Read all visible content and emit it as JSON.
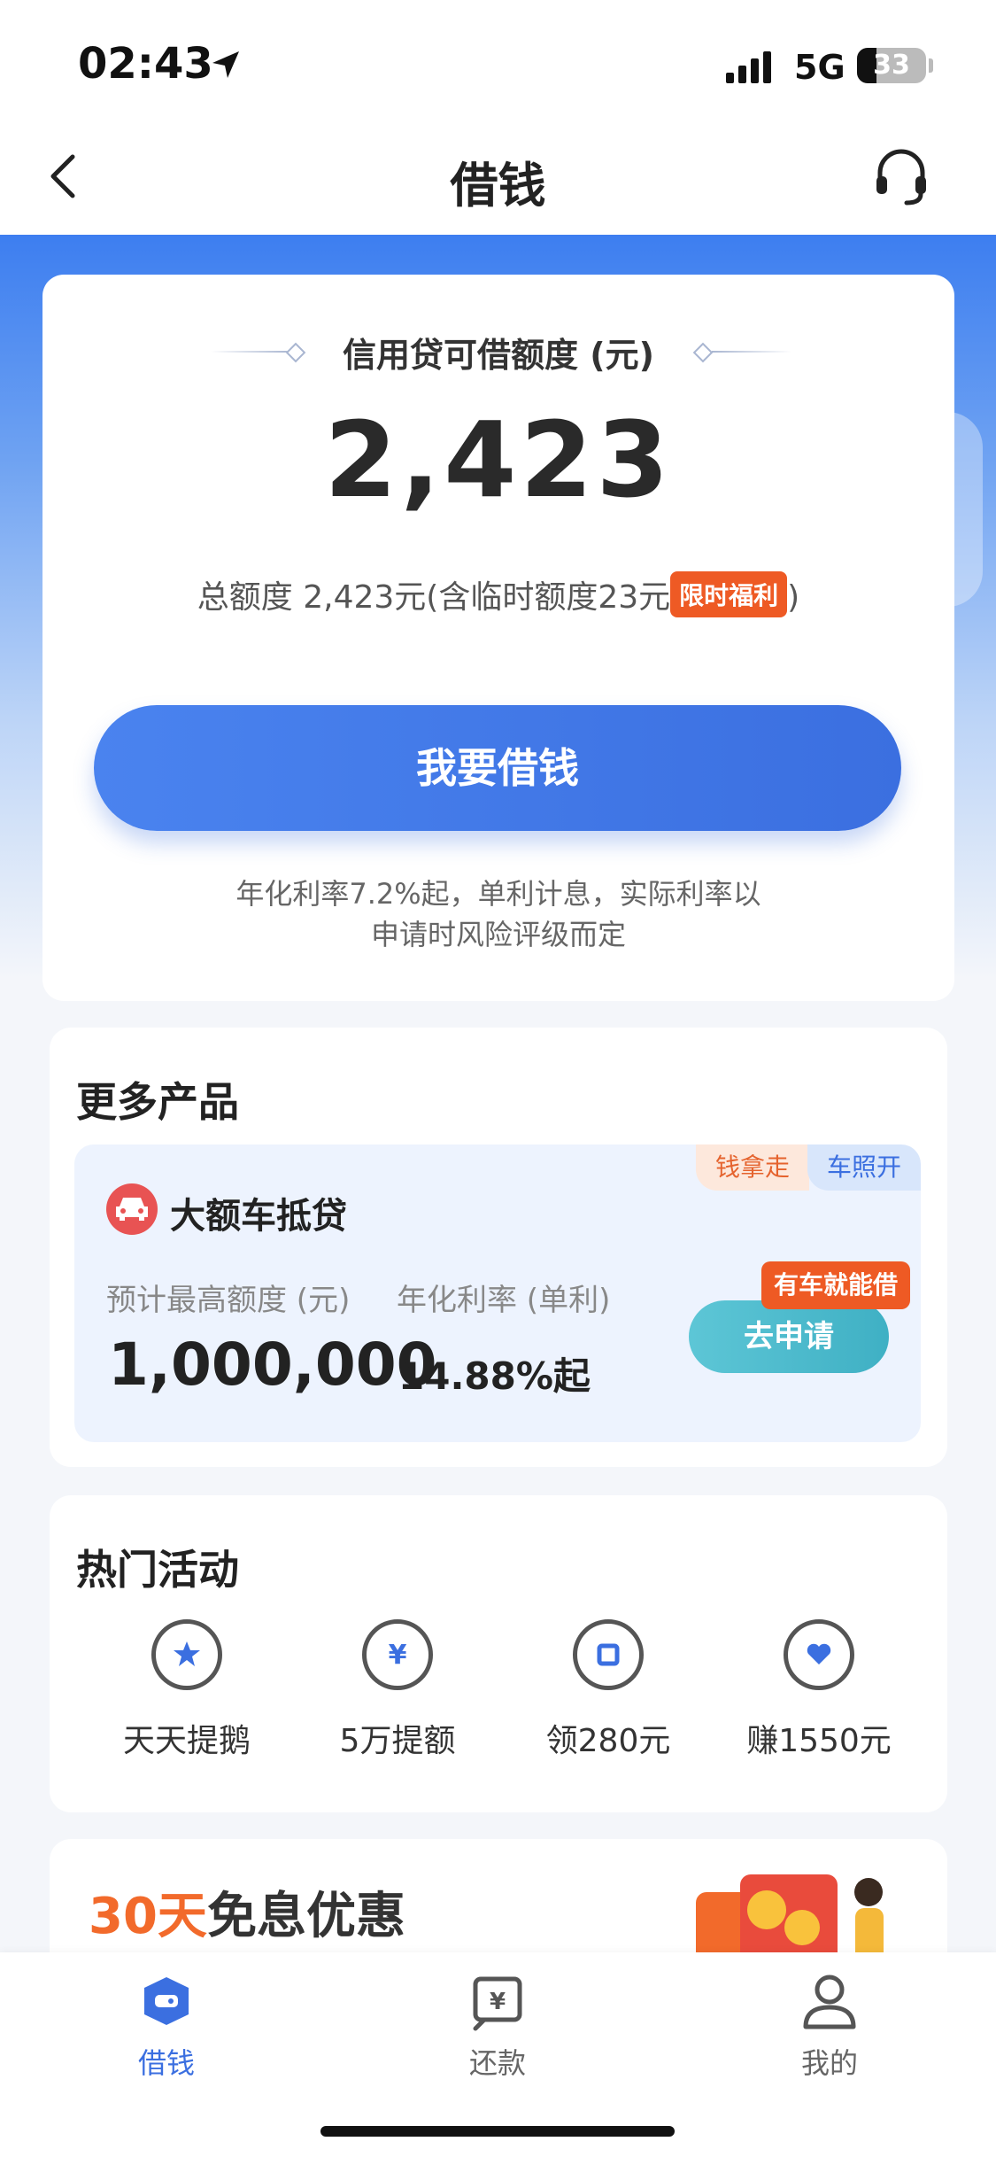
{
  "status_bar": {
    "time": "02:43",
    "network": "5G",
    "battery": "33"
  },
  "header": {
    "title": "借钱"
  },
  "credit": {
    "title": "信用贷可借额度 (元)",
    "amount": "2,423",
    "total_text": "总额度 2,423元(含临时额度23元",
    "promo_badge": "限时福利",
    "total_close": ")",
    "borrow_button": "我要借钱",
    "rate_note_line1": "年化利率7.2%起，单利计息，实际利率以",
    "rate_note_line2": "申请时风险评级而定"
  },
  "more_products": {
    "title": "更多产品",
    "tags": [
      "钱拿走",
      "车照开"
    ],
    "product_name": "大额车抵贷",
    "max_label": "预计最高额度 (元)",
    "rate_label": "年化利率 (单利)",
    "max_amount": "1,000,000",
    "rate_value": "14.88%起",
    "apply_button": "去申请",
    "apply_badge": "有车就能借"
  },
  "activities": {
    "title": "热门活动",
    "items": [
      {
        "label": "天天提鹅",
        "icon": "star-badge-icon"
      },
      {
        "label": "5万提额",
        "icon": "yuan-growth-icon"
      },
      {
        "label": "领280元",
        "icon": "square-coin-icon"
      },
      {
        "label": "赚1550元",
        "icon": "heart-badge-icon"
      }
    ]
  },
  "promo": {
    "accent": "30天",
    "rest": "免息优惠"
  },
  "tab_bar": {
    "tabs": [
      {
        "label": "借钱",
        "active": true,
        "icon": "wallet-icon"
      },
      {
        "label": "还款",
        "active": false,
        "icon": "repay-icon"
      },
      {
        "label": "我的",
        "active": false,
        "icon": "profile-icon"
      }
    ]
  },
  "colors": {
    "primary": "#3b6fe0",
    "orange": "#ee5a24",
    "teal": "#3fb0c4",
    "bg": "#f4f6fa"
  }
}
